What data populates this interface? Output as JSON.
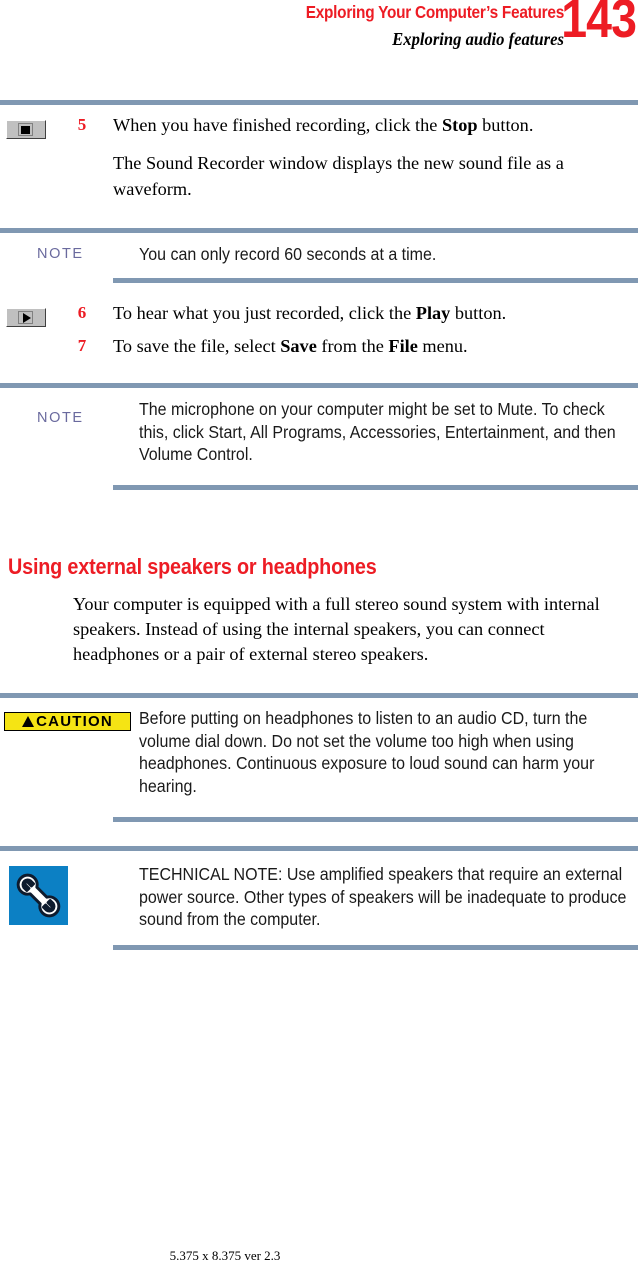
{
  "header": {
    "chapter_title": "Exploring Your Computer’s Features",
    "section_title": "Exploring audio features",
    "page_number": "143",
    "chapter_color": "#ed1c24"
  },
  "steps": [
    {
      "number": "5",
      "icon": "stop-button-icon",
      "paragraphs": [
        "When you have finished recording, click the Stop button.",
        "The Sound Recorder window displays the new sound file as a waveform."
      ],
      "bold_terms": [
        "Stop"
      ]
    },
    {
      "number": "6",
      "icon": "play-button-icon",
      "paragraphs": [
        "To hear what you just recorded, click the Play button."
      ],
      "bold_terms": [
        "Play"
      ]
    },
    {
      "number": "7",
      "icon": null,
      "paragraphs": [
        "To save the file, select Save from the File menu."
      ],
      "bold_terms": [
        "Save",
        "File"
      ]
    }
  ],
  "notes": [
    {
      "label": "NOTE",
      "label_color": "#6a6a9e",
      "text": "You can only record 60 seconds at a time."
    },
    {
      "label": "NOTE",
      "label_color": "#6a6a9e",
      "text": "The microphone on your computer might be set to Mute. To check this, click Start, All Programs, Accessories, Entertainment, and then Volume Control."
    }
  ],
  "section": {
    "heading": "Using external speakers or headphones",
    "heading_color": "#ed1c24",
    "body": "Your computer is equipped with a full stereo sound system with internal speakers. Instead of using the internal speakers, you can connect headphones or a pair of external stereo speakers."
  },
  "caution": {
    "badge_label": "CAUTION",
    "badge_bg": "#f5e414",
    "icon": "warning-triangle-icon",
    "text": "Before putting on headphones to listen to an audio CD, turn the volume dial down. Do not set the volume too high when using headphones. Continuous exposure to loud sound can harm your hearing."
  },
  "technical_note": {
    "icon": "wrench-icon",
    "icon_bg": "#0c80c4",
    "text": "TECHNICAL NOTE: Use amplified speakers that require an external power source. Other types of speakers will be inadequate to produce sound from the computer."
  },
  "footer": {
    "text": "5.375 x 8.375 ver 2.3"
  },
  "rule_color": "#8098b2"
}
